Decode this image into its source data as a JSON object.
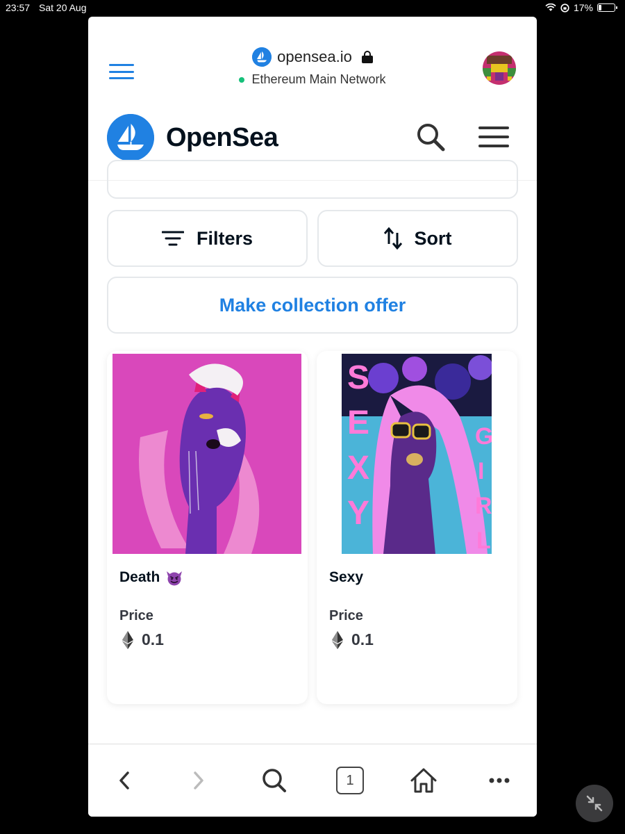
{
  "status_bar": {
    "time": "23:57",
    "date": "Sat 20 Aug",
    "battery": "17%",
    "battery_level": 0.17
  },
  "url_bar": {
    "domain": "opensea.io",
    "network": "Ethereum Main Network"
  },
  "header": {
    "brand": "OpenSea"
  },
  "actions": {
    "filters_label": "Filters",
    "sort_label": "Sort",
    "offer_label": "Make collection offer"
  },
  "items": [
    {
      "name": "Death",
      "emoji": "😈",
      "price_label": "Price",
      "price": "0.1"
    },
    {
      "name": "Sexy",
      "price_label": "Price",
      "price": "0.1"
    }
  ],
  "toolbar": {
    "tab_count": "1"
  },
  "colors": {
    "accent": "#2081e2",
    "text": "#04111d",
    "border": "#e5e8eb",
    "art_pink": "#d63fb4",
    "art_purple": "#6a2fb0"
  },
  "icons": [
    "menu-icon",
    "opensea-icon",
    "lock-icon",
    "search-icon",
    "hamburger-icon",
    "filter-icon",
    "sort-icon",
    "ethereum-icon",
    "back-icon",
    "forward-icon",
    "tabs-icon",
    "home-icon",
    "more-icon",
    "minimize-icon"
  ]
}
